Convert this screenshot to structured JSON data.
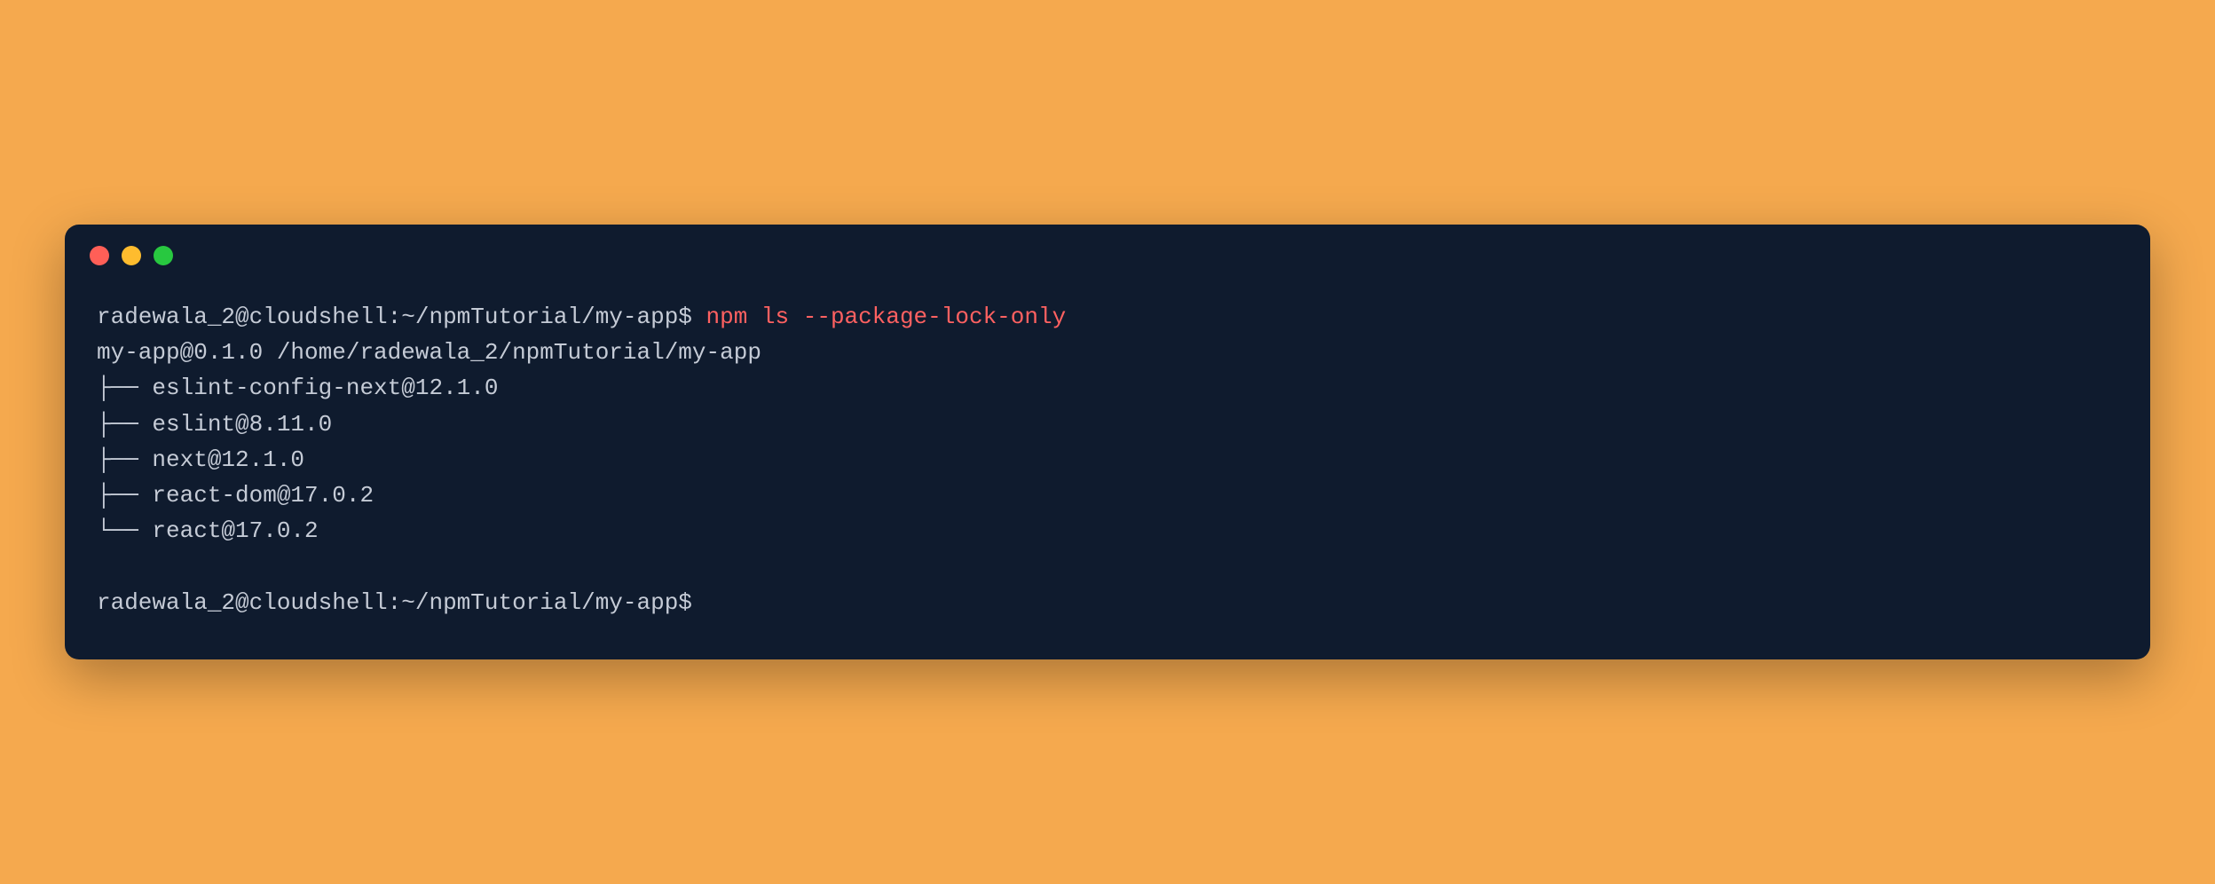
{
  "terminal": {
    "prompt1": "radewala_2@cloudshell:~/npmTutorial/my-app$ ",
    "command1": "npm ls --package-lock-only",
    "output": {
      "header": "my-app@0.1.0 /home/radewala_2/npmTutorial/my-app",
      "tree": [
        "├── eslint-config-next@12.1.0",
        "├── eslint@8.11.0",
        "├── next@12.1.0",
        "├── react-dom@17.0.2",
        "└── react@17.0.2"
      ]
    },
    "prompt2": "radewala_2@cloudshell:~/npmTutorial/my-app$"
  }
}
